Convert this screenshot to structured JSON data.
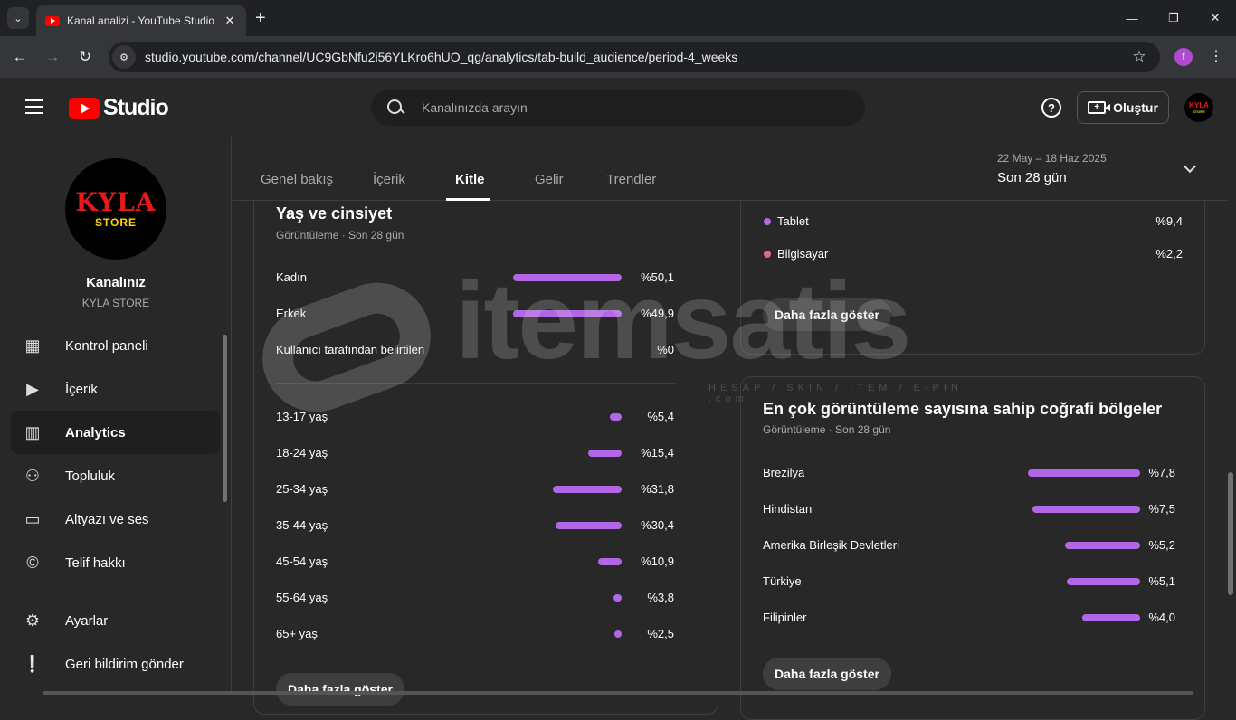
{
  "browser": {
    "tab_title": "Kanal analizi - YouTube Studio",
    "url": "studio.youtube.com/channel/UC9GbNfu2i56YLKro6hUO_qg/analytics/tab-build_audience/period-4_weeks",
    "profile_initial": "f",
    "icons": {
      "tab_list": "chevron-down-icon",
      "close": "close-icon",
      "new_tab": "plus-icon",
      "back": "back-arrow-icon",
      "forward": "forward-arrow-icon",
      "reload": "reload-icon",
      "site_info": "tune-icon",
      "bookmark": "star-icon",
      "menu": "kebab-icon"
    }
  },
  "header": {
    "logo_text": "Studio",
    "search_placeholder": "Kanalınızda arayın",
    "create_label": "Oluştur",
    "avatar_text_top": "KYLA",
    "avatar_text_bottom": "STORE"
  },
  "sidebar": {
    "avatar_top": "KYLA",
    "avatar_bottom": "STORE",
    "channel_title": "Kanalınız",
    "channel_name": "KYLA STORE",
    "items": [
      {
        "label": "Kontrol paneli",
        "icon": "dashboard-icon",
        "active": false
      },
      {
        "label": "İçerik",
        "icon": "content-icon",
        "active": false
      },
      {
        "label": "Analytics",
        "icon": "analytics-icon",
        "active": true
      },
      {
        "label": "Topluluk",
        "icon": "community-icon",
        "active": false
      },
      {
        "label": "Altyazı ve ses",
        "icon": "subtitles-icon",
        "active": false
      },
      {
        "label": "Telif hakkı",
        "icon": "copyright-icon",
        "active": false
      }
    ],
    "bottom_items": [
      {
        "label": "Ayarlar",
        "icon": "gear-icon"
      },
      {
        "label": "Geri bildirim gönder",
        "icon": "feedback-icon"
      }
    ]
  },
  "analytics": {
    "tabs": [
      "Genel bakış",
      "İçerik",
      "Kitle",
      "Gelir",
      "Trendler"
    ],
    "active_tab": "Kitle",
    "date_range": "22 May – 18 Haz 2025",
    "period": "Son 28 gün"
  },
  "age_gender": {
    "title": "Yaş ve cinsiyet",
    "subtitle": "Görüntüleme · Son 28 gün",
    "gender": [
      {
        "label": "Kadın",
        "value": "%50,1",
        "pct": 50.1
      },
      {
        "label": "Erkek",
        "value": "%49,9",
        "pct": 49.9
      },
      {
        "label": "Kullanıcı tarafından belirtilen",
        "value": "%0",
        "pct": 0
      }
    ],
    "ages": [
      {
        "label": "13-17 yaş",
        "value": "%5,4",
        "pct": 5.4
      },
      {
        "label": "18-24 yaş",
        "value": "%15,4",
        "pct": 15.4
      },
      {
        "label": "25-34 yaş",
        "value": "%31,8",
        "pct": 31.8
      },
      {
        "label": "35-44 yaş",
        "value": "%30,4",
        "pct": 30.4
      },
      {
        "label": "45-54 yaş",
        "value": "%10,9",
        "pct": 10.9
      },
      {
        "label": "55-64 yaş",
        "value": "%3,8",
        "pct": 3.8
      },
      {
        "label": "65+ yaş",
        "value": "%2,5",
        "pct": 2.5
      }
    ],
    "more_label": "Daha fazla göster"
  },
  "devices": {
    "rows": [
      {
        "label": "Tablet",
        "value": "%9,4",
        "color": "#b267e6"
      },
      {
        "label": "Bilgisayar",
        "value": "%2,2",
        "color": "#e85d9c"
      }
    ],
    "more_label": "Daha fazla göster"
  },
  "geography": {
    "title": "En çok görüntüleme sayısına sahip coğrafi bölgeler",
    "subtitle": "Görüntüleme · Son 28 gün",
    "rows": [
      {
        "label": "Brezilya",
        "value": "%7,8",
        "pct": 7.8
      },
      {
        "label": "Hindistan",
        "value": "%7,5",
        "pct": 7.5
      },
      {
        "label": "Amerika Birleşik Devletleri",
        "value": "%5,2",
        "pct": 5.2
      },
      {
        "label": "Türkiye",
        "value": "%5,1",
        "pct": 5.1
      },
      {
        "label": "Filipinler",
        "value": "%4,0",
        "pct": 4.0
      }
    ],
    "more_label": "Daha fazla göster"
  },
  "watermark": {
    "text": "itemsatis",
    "sub": "HESAP / SKIN / ITEM / E-PIN",
    "com": ".com"
  },
  "colors": {
    "bar": "#b267e6",
    "accent_red": "#ff0000",
    "background": "#282828"
  }
}
